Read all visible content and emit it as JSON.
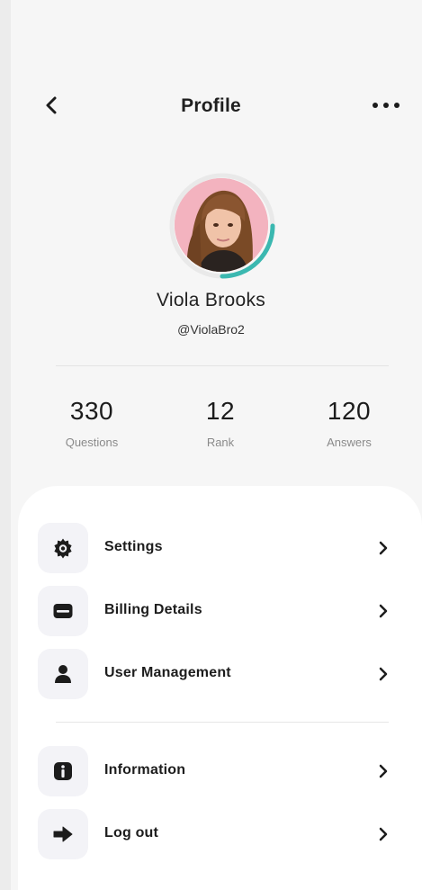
{
  "header": {
    "title": "Profile"
  },
  "profile": {
    "name": "Viola Brooks",
    "handle": "@ViolaBro2"
  },
  "stats": [
    {
      "value": "330",
      "label": "Questions"
    },
    {
      "value": "12",
      "label": "Rank"
    },
    {
      "value": "120",
      "label": "Answers"
    }
  ],
  "menu": {
    "primary": [
      {
        "label": "Settings",
        "icon": "gear-icon"
      },
      {
        "label": "Billing Details",
        "icon": "credit-card-icon"
      },
      {
        "label": "User Management",
        "icon": "user-icon"
      }
    ],
    "secondary": [
      {
        "label": "Information",
        "icon": "info-icon"
      },
      {
        "label": "Log out",
        "icon": "logout-arrow-icon"
      }
    ]
  },
  "colors": {
    "accent_ring": "#3bb8b0",
    "card_bg": "#ffffff",
    "icon_box_bg": "#f3f3f7"
  }
}
